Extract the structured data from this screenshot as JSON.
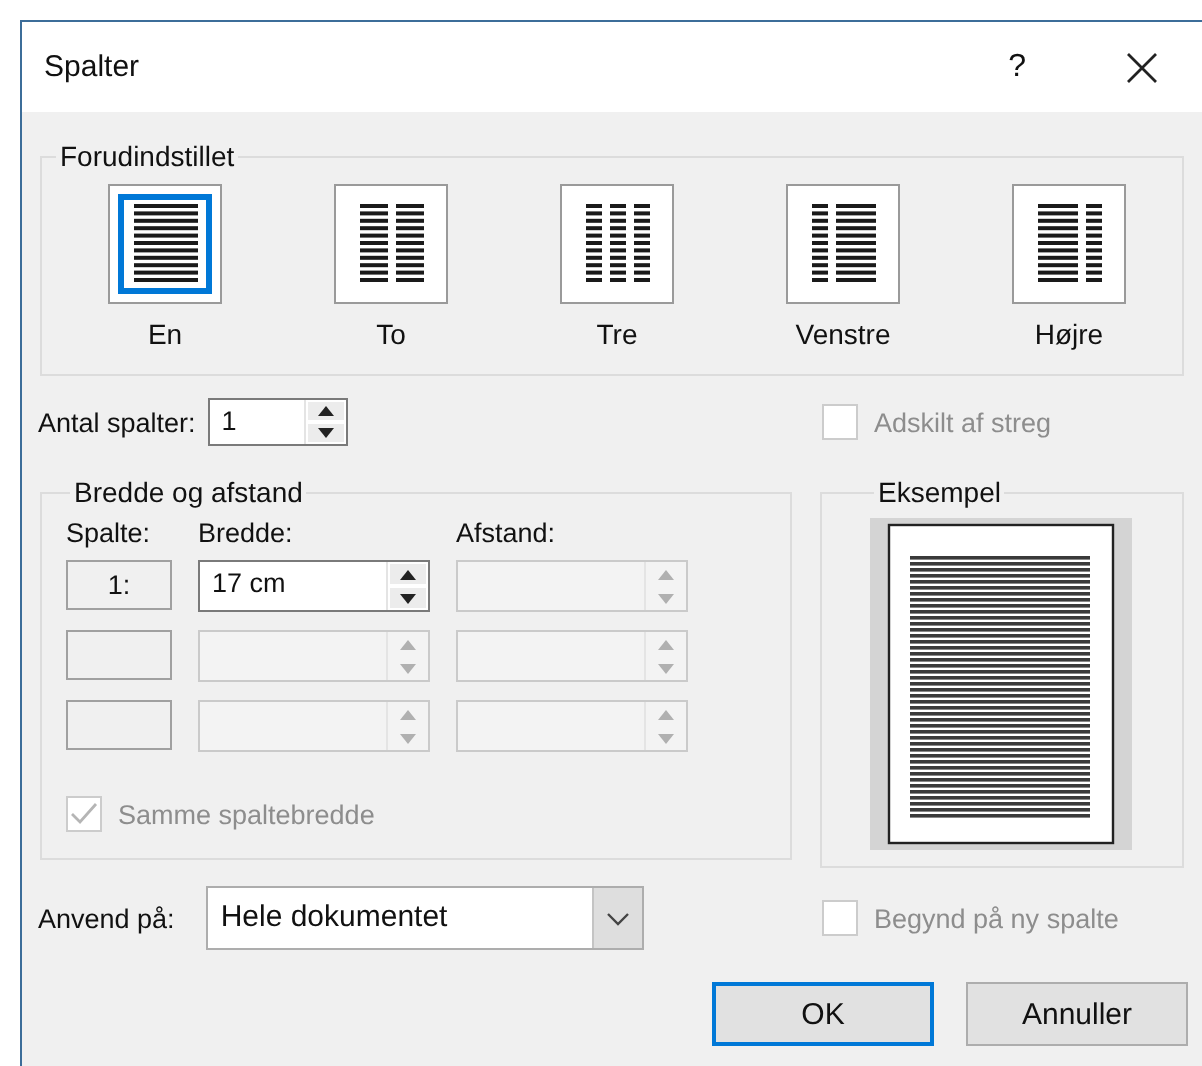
{
  "window": {
    "title": "Spalter",
    "help": "?"
  },
  "presets": {
    "label": "Forudindstillet",
    "items": [
      {
        "label": "En",
        "kind": "one",
        "selected": true
      },
      {
        "label": "To",
        "kind": "two",
        "selected": false
      },
      {
        "label": "Tre",
        "kind": "three",
        "selected": false
      },
      {
        "label": "Venstre",
        "kind": "left",
        "selected": false
      },
      {
        "label": "Højre",
        "kind": "right",
        "selected": false
      }
    ]
  },
  "number_of_columns": {
    "label": "Antal spalter:",
    "value": "1"
  },
  "line_between": {
    "label": "Adskilt af streg",
    "checked": false,
    "disabled": true
  },
  "width_and_spacing": {
    "label": "Bredde og afstand",
    "headers": [
      "Spalte:",
      "Bredde:",
      "Afstand:"
    ],
    "rows": [
      {
        "column": "1:",
        "width": "17 cm",
        "width_disabled": false,
        "spacing_disabled": true
      },
      {
        "width_disabled": true,
        "spacing_disabled": true
      },
      {
        "width_disabled": true,
        "spacing_disabled": true
      }
    ],
    "equal_width": {
      "label": "Samme spaltebredde",
      "checked": true,
      "disabled": true
    }
  },
  "preview": {
    "label": "Eksempel"
  },
  "apply_to": {
    "label": "Anvend på:",
    "value": "Hele dokumentet"
  },
  "start_new_column": {
    "label": "Begynd på ny spalte",
    "checked": false,
    "disabled": true
  },
  "buttons": [
    {
      "label": "OK",
      "kind": "default"
    },
    {
      "label": "Annuller",
      "kind": "normal"
    }
  ]
}
